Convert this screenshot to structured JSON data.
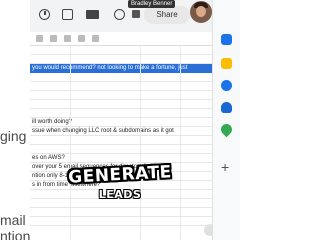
{
  "left_sliver": {
    "line1": "ging L",
    "line2": "mail s",
    "line3": "ntion"
  },
  "header": {
    "share_label": "Share",
    "user_name": "Bradley Benner"
  },
  "sheet": {
    "rows": [
      {
        "text": "",
        "style": ""
      },
      {
        "text": "",
        "style": ""
      },
      {
        "text": "you would recommend? not looking to make a fortune, just",
        "style": "selected"
      },
      {
        "text": "",
        "style": ""
      },
      {
        "text": "",
        "style": ""
      },
      {
        "text": "",
        "style": ""
      },
      {
        "text": "",
        "style": ""
      },
      {
        "text": "",
        "style": ""
      },
      {
        "text": "ill worth doing?",
        "style": ""
      },
      {
        "text": "ssue when changing LLC root & subdomains as it got",
        "style": ""
      },
      {
        "text": "",
        "style": ""
      },
      {
        "text": "",
        "style": ""
      },
      {
        "text": "es on AWS?",
        "style": ""
      },
      {
        "text": "over your 5 email sequences for directory listing out",
        "style": ""
      },
      {
        "text": "ntion only 8-10k a month, is there an ea",
        "style": ""
      },
      {
        "text": "s in from time elsewhere?",
        "style": ""
      },
      {
        "text": "",
        "style": ""
      },
      {
        "text": "",
        "style": ""
      },
      {
        "text": "",
        "style": ""
      },
      {
        "text": "",
        "style": ""
      }
    ]
  },
  "overlay": {
    "line1": "GENERATE",
    "line2": "LEADS"
  },
  "colors": {
    "selection": "#2a6fd6",
    "topbar": "#f1f3f4"
  },
  "icons": {
    "topbar": [
      "clock-icon",
      "chat-icon",
      "video-icon",
      "globe-icon",
      "lock-icon"
    ],
    "right_panel": [
      "calendar-icon",
      "keep-icon",
      "tasks-icon",
      "contacts-icon",
      "maps-icon",
      "plus-icon"
    ]
  }
}
